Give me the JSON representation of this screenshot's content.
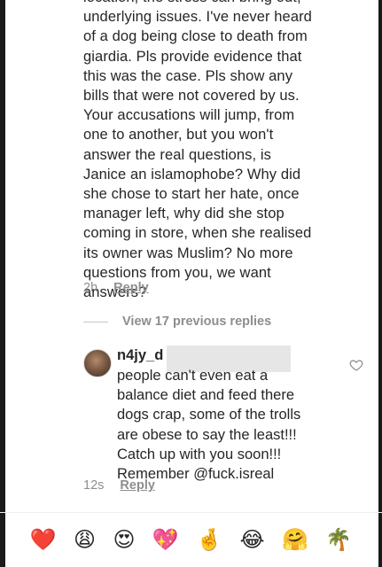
{
  "comment": {
    "text_lines": "location, the stress can bring out,\nunderlying issues. I've never heard\nof a dog being close to death from\ngiardia. Pls provide evidence that\nthis was the case. Pls show any\nbills that were not covered by us.\nYour accusations will jump, from\none to another, but you won't\nanswer the real questions, is\nJanice an islamophobe? Why did\nshe chose to start her hate, once\nmanager left, why did she stop\ncoming in store, when she realised\nits owner was Muslim? No more\nquestions from you, we want\nanswers?",
    "time": "2h",
    "reply_label": "Reply"
  },
  "view_replies_label": "View 17 previous replies",
  "reply": {
    "username": "n4jy_d",
    "text_lines": "people can't even eat a\nbalance diet and feed there\ndogs crap, some of the trolls\nare obese to say the least!!!\nCatch up with you soon!!!\nRemember @fuck.isreal",
    "time": "12s",
    "reply_label": "Reply"
  },
  "emoji_bar": {
    "items": [
      {
        "name": "red-heart-icon",
        "glyph": "❤️"
      },
      {
        "name": "weary-face-icon",
        "glyph": "😩"
      },
      {
        "name": "heart-eyes-icon",
        "glyph": "😍"
      },
      {
        "name": "sparkling-heart-icon",
        "glyph": "💖"
      },
      {
        "name": "crossed-fingers-icon",
        "glyph": "🤞"
      },
      {
        "name": "tears-of-joy-icon",
        "glyph": "😂"
      },
      {
        "name": "hugging-face-icon",
        "glyph": "🤗"
      },
      {
        "name": "palm-tree-icon",
        "glyph": "🌴"
      }
    ]
  }
}
